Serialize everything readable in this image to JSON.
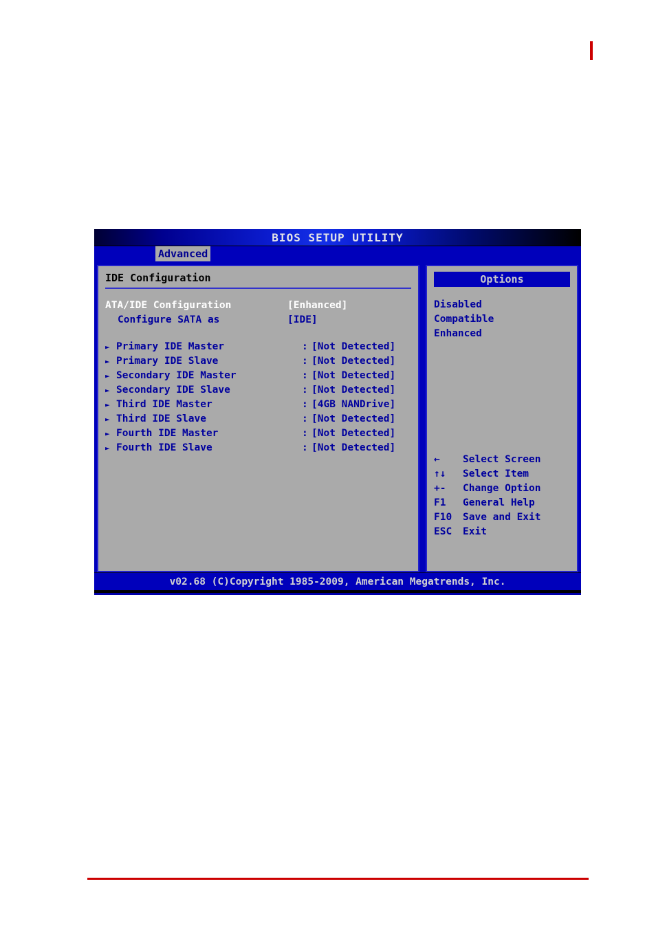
{
  "page": {
    "accent_red": "#cc0000",
    "bios_blue": "#0000bb",
    "panel_gray": "#aaaaaa",
    "text_blue": "#00009e"
  },
  "bios": {
    "title": "BIOS SETUP UTILITY",
    "active_tab": "Advanced",
    "section_title": "IDE Configuration",
    "settings": [
      {
        "label": "ATA/IDE Configuration",
        "value": "[Enhanced]",
        "selected": true,
        "indent": false
      },
      {
        "label": "Configure SATA as",
        "value": "[IDE]",
        "selected": false,
        "indent": true
      }
    ],
    "devices": [
      {
        "arrow": "triangle-right-icon",
        "label": "Primary IDE Master",
        "colon": ":",
        "value": "[Not Detected]"
      },
      {
        "arrow": "triangle-right-icon",
        "label": "Primary IDE Slave",
        "colon": ":",
        "value": "[Not Detected]"
      },
      {
        "arrow": "triangle-right-icon",
        "label": "Secondary IDE Master",
        "colon": ":",
        "value": "[Not Detected]"
      },
      {
        "arrow": "triangle-right-icon",
        "label": "Secondary IDE Slave",
        "colon": ":",
        "value": "[Not Detected]"
      },
      {
        "arrow": "triangle-right-icon",
        "label": "Third IDE Master",
        "colon": ":",
        "value": "[4GB NANDrive]"
      },
      {
        "arrow": "triangle-right-icon",
        "label": "Third IDE Slave",
        "colon": ":",
        "value": "[Not Detected]"
      },
      {
        "arrow": "triangle-right-icon",
        "label": "Fourth IDE Master",
        "colon": ":",
        "value": "[Not Detected]"
      },
      {
        "arrow": "triangle-right-icon",
        "label": "Fourth IDE Slave",
        "colon": ":",
        "value": "[Not Detected]"
      }
    ],
    "options": {
      "header": "Options",
      "items": [
        "Disabled",
        "Compatible",
        "Enhanced"
      ]
    },
    "key_help": [
      {
        "key": "←",
        "desc": "Select Screen"
      },
      {
        "key": "↑↓",
        "desc": "Select Item"
      },
      {
        "key": "+-",
        "desc": "Change Option"
      },
      {
        "key": "F1",
        "desc": "General Help"
      },
      {
        "key": "F10",
        "desc": "Save and Exit"
      },
      {
        "key": "ESC",
        "desc": "Exit"
      }
    ],
    "footer": "v02.68 (C)Copyright 1985-2009, American Megatrends, Inc."
  }
}
